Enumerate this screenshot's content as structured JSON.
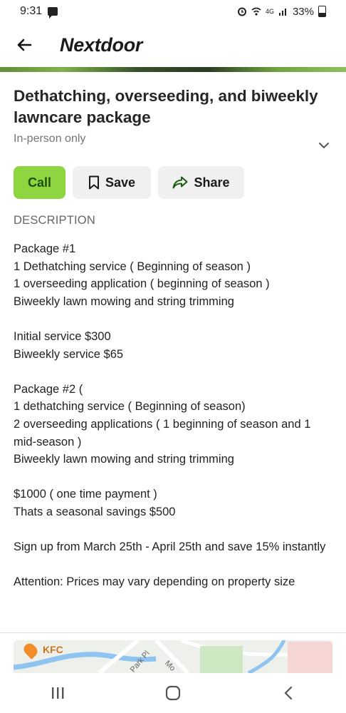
{
  "status_bar": {
    "time": "9:31",
    "network": "4G",
    "battery": "33%"
  },
  "header": {
    "app_title": "Nextdoor"
  },
  "listing": {
    "title": "Dethatching, overseeding, and biweekly lawncare package",
    "subtitle": "In-person only"
  },
  "actions": {
    "call_label": "Call",
    "save_label": "Save",
    "share_label": "Share"
  },
  "description": {
    "section_label": "DESCRIPTION",
    "paragraphs": [
      [
        "Package #1",
        "1 Dethatching service ( Beginning of season )",
        "1 overseeding application ( beginning of season )",
        "Biweekly lawn mowing and string trimming"
      ],
      [
        "Initial service $300",
        "Biweekly service $65"
      ],
      [
        "Package #2 (",
        "1 dethatching service ( Beginning of season)",
        "2 overseeding applications ( 1 beginning of season and 1 mid-season )",
        "Biweekly lawn mowing and string trimming"
      ],
      [
        "$1000 ( one time payment )",
        "Thats a seasonal savings $500"
      ],
      [
        "Sign up from March 25th - April 25th and save 15% instantly"
      ],
      [
        "Attention: Prices may vary depending on property size"
      ]
    ]
  },
  "map": {
    "poi_label": "KFC",
    "street_1": "Park Pl",
    "street_2": "Mo"
  },
  "colors": {
    "call_button": "#8ed63f",
    "secondary_button": "#f0f0f0",
    "text_primary": "#262626",
    "text_muted": "#757575"
  },
  "icons": {
    "back": "back-arrow-icon",
    "chevron": "chevron-down-icon",
    "save": "bookmark-icon",
    "share": "share-arrow-icon",
    "recents": "recents-icon",
    "home": "home-icon",
    "nav_back": "nav-back-icon"
  }
}
